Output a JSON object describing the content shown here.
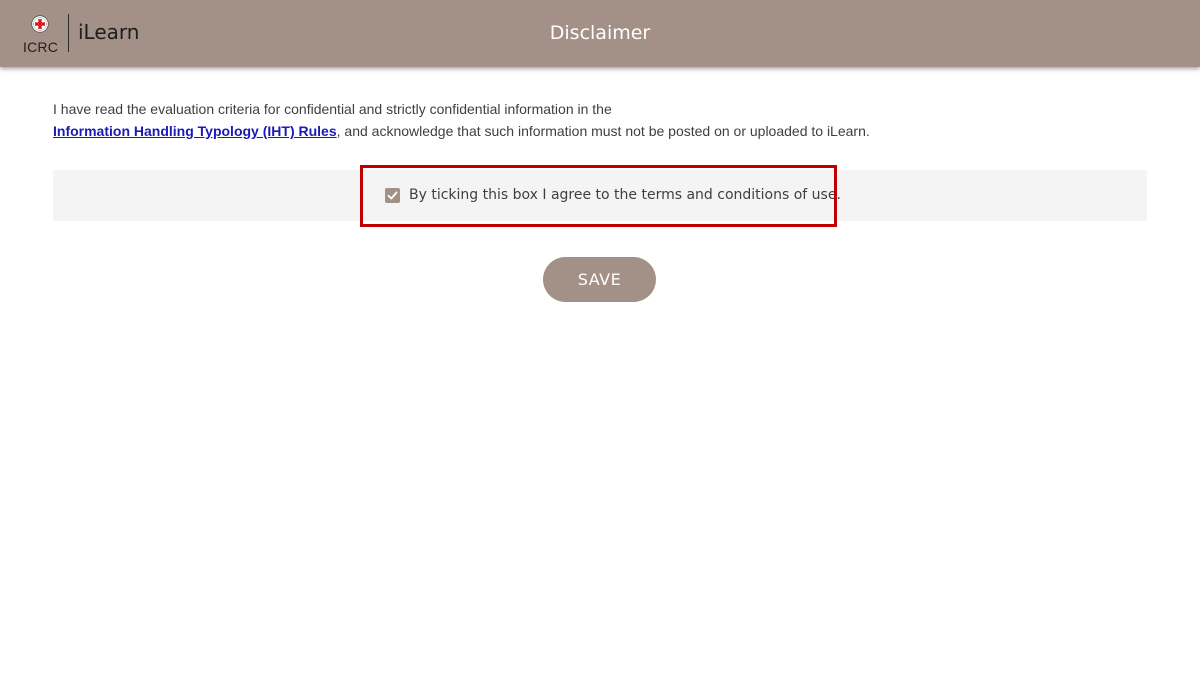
{
  "header": {
    "logo_text": "ICRC",
    "app_name": "iLearn",
    "title": "Disclaimer"
  },
  "content": {
    "intro_text_1": "I have read the evaluation criteria for confidential and strictly confidential information in the",
    "link_text": "Information Handling Typology (IHT) Rules",
    "intro_text_2": ", and acknowledge that such information must not be posted on or uploaded to iLearn."
  },
  "agreement": {
    "checked": true,
    "label": "By ticking this box I agree to the terms and conditions of use."
  },
  "actions": {
    "save_label": "SAVE"
  },
  "icons": {
    "logo_emblem": "red-cross-emblem-icon",
    "checkbox_mark": "check-icon"
  },
  "colors": {
    "header_bg": "#a39086",
    "link": "#1a1ab8",
    "highlight": "#c00000",
    "emblem_red": "#d81e1e"
  }
}
